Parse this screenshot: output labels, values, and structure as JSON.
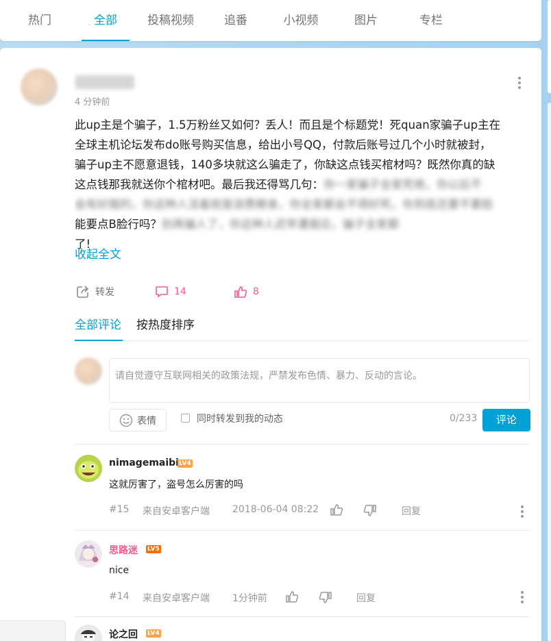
{
  "tabs": [
    {
      "label": "热门"
    },
    {
      "label": "全部"
    },
    {
      "label": "投稿视频"
    },
    {
      "label": "追番"
    },
    {
      "label": "小视频"
    },
    {
      "label": "图片"
    },
    {
      "label": "专栏"
    }
  ],
  "active_tab": "全部",
  "post": {
    "time": "4 分钟前",
    "lines": [
      "此up主是个骗子，1.5万粉丝又如何？丢人！而且是个标题党！死quan家骗子up主在",
      "全球主机论坛发布do账号购买信息，给出小号QQ，付款后账号过几个小时就被封，",
      "骗子up主不愿意退钱，140多块就这么骗走了，你缺这点钱买棺材吗？既然你真的缺",
      "这点钱那我就送你个棺材吧。最后我还得骂几句："
    ],
    "line4_blurred": "你一家骗子全家死绝，你以后不",
    "line5_blurred": "会有好报的，你这种人活着就是浪费粮食，你全家都会不得好死，你到底还要不要脸",
    "line6_start": "能要点B脸行吗？",
    "line6_blurred": "别再骗人了，你这种人迟早遭报应，骗子全家都",
    "line7": "了!",
    "expand": "收起全文",
    "actions": {
      "share": "转发",
      "comments": "14",
      "likes": "8"
    }
  },
  "comment_section": {
    "sort_all": "全部评论",
    "sort_hot": "按热度排序",
    "placeholder": "请自觉遵守互联网相关的政策法规，严禁发布色情、暴力、反动的言论。",
    "emoji": "表情",
    "sync_label": "同时转发到我的动态",
    "counter": "0/233",
    "submit": "评论"
  },
  "comments": [
    {
      "user": "nimagemaibi",
      "level": "LV4",
      "text": "这就厉害了，盗号怎么厉害的吗",
      "floor": "#15",
      "source": "来自安卓客户端",
      "time": "2018-06-04 08:22",
      "reply": "回复"
    },
    {
      "user": "思路迷",
      "level": "LV5",
      "text": "nice",
      "floor": "#14",
      "source": "来自安卓客户端",
      "time": "1分钟前",
      "reply": "回复"
    },
    {
      "user": "论之回",
      "level": "LV4"
    }
  ],
  "colors": {
    "accent": "#00a1d6",
    "pink": "#f25d8e",
    "lv4": "#fea249",
    "lv5": "#ff6c00"
  }
}
